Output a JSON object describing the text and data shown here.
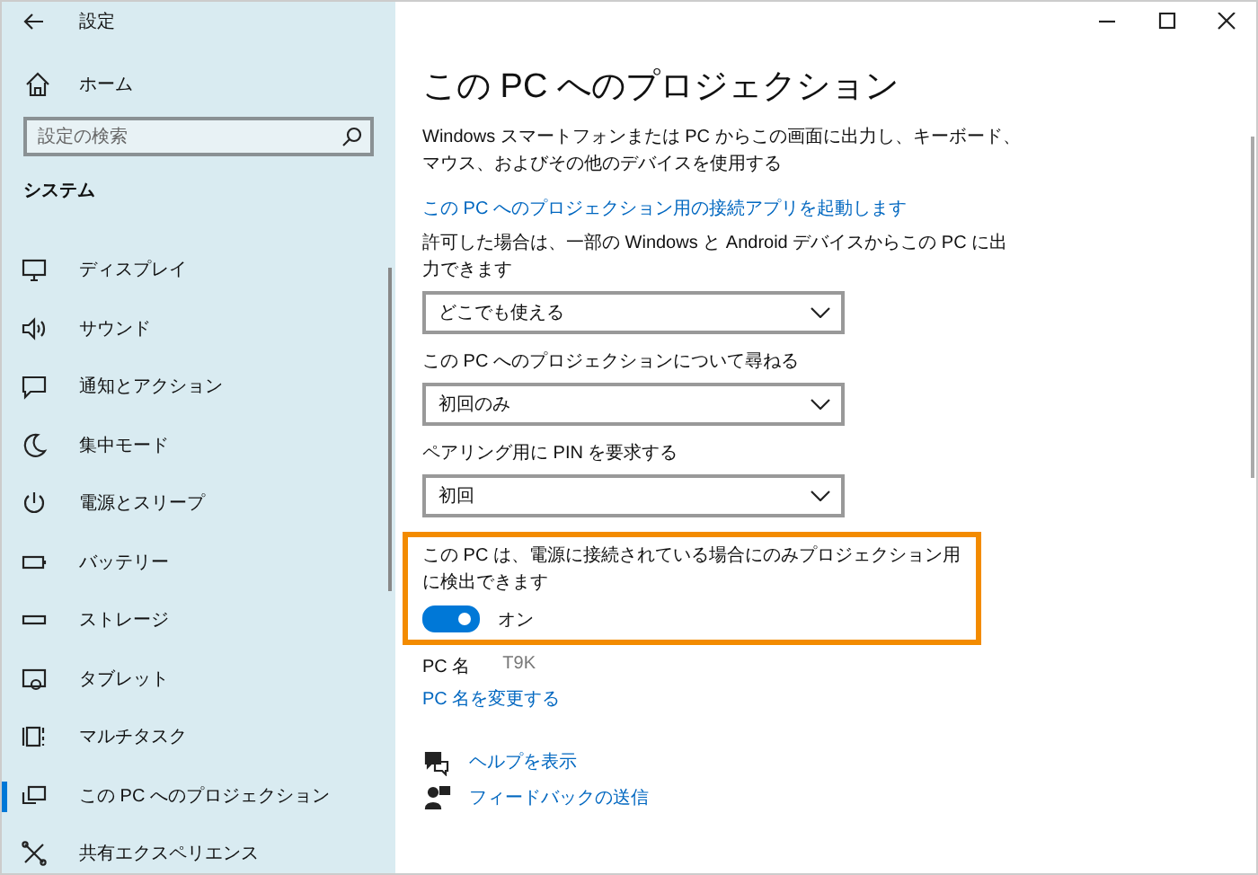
{
  "window": {
    "title": "設定"
  },
  "sidebar": {
    "home": "ホーム",
    "search": {
      "placeholder": "設定の検索"
    },
    "section": "システム",
    "items": [
      {
        "label": "ディスプレイ",
        "selected": false
      },
      {
        "label": "サウンド",
        "selected": false
      },
      {
        "label": "通知とアクション",
        "selected": false
      },
      {
        "label": "集中モード",
        "selected": false
      },
      {
        "label": "電源とスリープ",
        "selected": false
      },
      {
        "label": "バッテリー",
        "selected": false
      },
      {
        "label": "ストレージ",
        "selected": false
      },
      {
        "label": "タブレット",
        "selected": false
      },
      {
        "label": "マルチタスク",
        "selected": false
      },
      {
        "label": "この PC へのプロジェクション",
        "selected": true
      },
      {
        "label": "共有エクスペリエンス",
        "selected": false
      }
    ]
  },
  "main": {
    "title": "この PC へのプロジェクション",
    "description": "Windows スマートフォンまたは PC からこの画面に出力し、キーボード、マウス、およびその他のデバイスを使用する",
    "launch_link": "この PC へのプロジェクション用の接続アプリを起動します",
    "settings": [
      {
        "kind": "dropdown",
        "label": "許可した場合は、一部の Windows と Android デバイスからこの PC に出力できます",
        "value": "どこでも使える"
      },
      {
        "kind": "dropdown",
        "label": "この PC へのプロジェクションについて尋ねる",
        "value": "初回のみ"
      },
      {
        "kind": "dropdown",
        "label": "ペアリング用に PIN を要求する",
        "value": "初回"
      },
      {
        "kind": "toggle",
        "label": "この PC は、電源に接続されている場合にのみプロジェクション用に検出できます",
        "on": true,
        "state_text": "オン",
        "highlighted": true
      }
    ],
    "pc_name_label": "PC 名",
    "pc_name": "T9K",
    "rename_link": "PC 名を変更する",
    "help_links": [
      "ヘルプを表示",
      "フィードバックの送信"
    ]
  }
}
